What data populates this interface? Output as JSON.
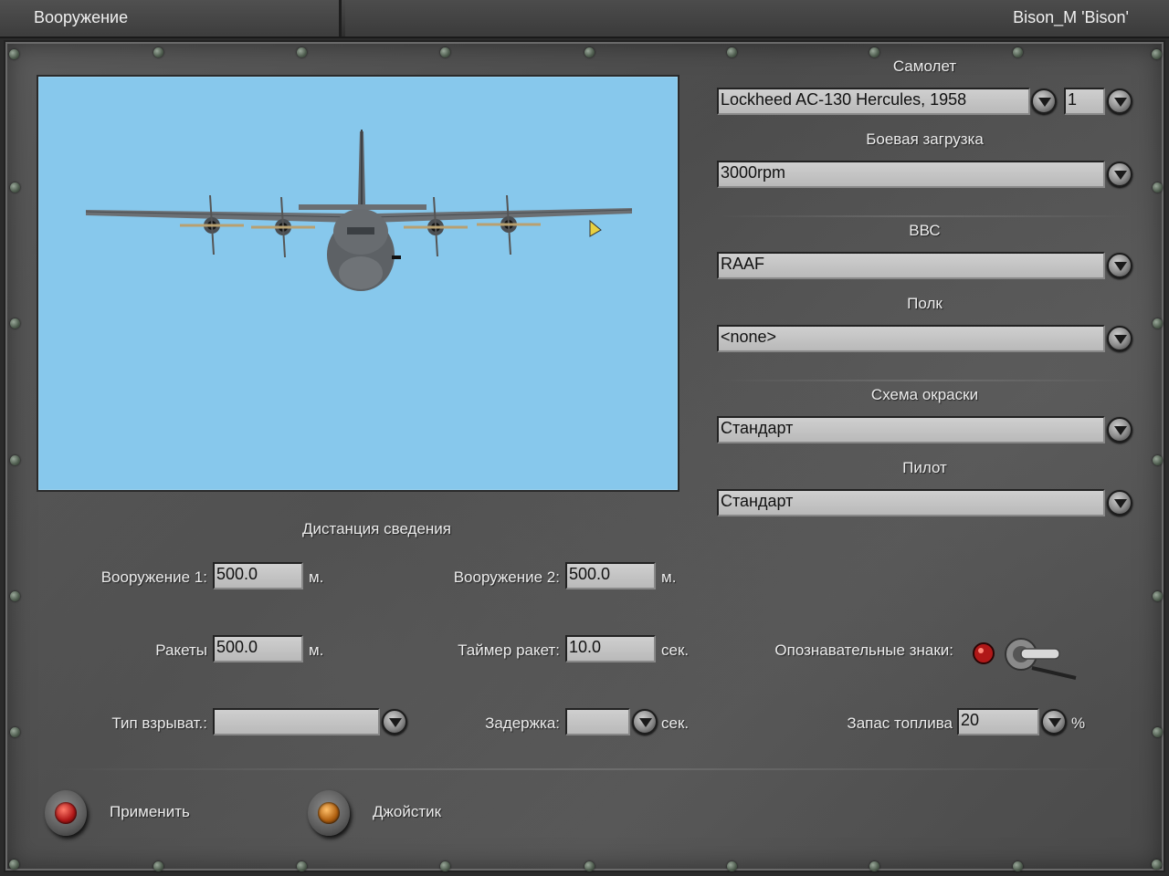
{
  "window": {
    "title": "Вооружение",
    "user": "Bison_M 'Bison'"
  },
  "aircraft": {
    "label": "Самолет",
    "model": "Lockheed AC-130 Hercules, 1958",
    "count": "1"
  },
  "loadout": {
    "label": "Боевая загрузка",
    "value": "3000rpm"
  },
  "air_force": {
    "label": "ВВС",
    "value": "RAAF"
  },
  "regiment": {
    "label": "Полк",
    "value": "<none>"
  },
  "skin": {
    "label": "Схема окраски",
    "value": "Стандарт"
  },
  "pilot": {
    "label": "Пилот",
    "value": "Стандарт"
  },
  "convergence": {
    "title": "Дистанция сведения",
    "weapon1_label": "Вооружение 1:",
    "weapon1_value": "500.0",
    "weapon1_unit": "м.",
    "weapon2_label": "Вооружение 2:",
    "weapon2_value": "500.0",
    "weapon2_unit": "м.",
    "rockets_label": "Ракеты",
    "rockets_value": "500.0",
    "rockets_unit": "м.",
    "rocket_timer_label": "Таймер ракет:",
    "rocket_timer_value": "10.0",
    "rocket_timer_unit": "сек.",
    "fuze_label": "Тип взрыват.:",
    "fuze_value": "",
    "delay_label": "Задержка:",
    "delay_value": "",
    "delay_unit": "сек."
  },
  "markings": {
    "label": "Опознавательные знаки:"
  },
  "fuel": {
    "label": "Запас топлива",
    "value": "20",
    "unit": "%"
  },
  "buttons": {
    "apply": "Применить",
    "joystick": "Джойстик"
  },
  "icons": {
    "dropdown": "chevron-down-icon",
    "apply_lamp": "red-lamp-icon",
    "joystick_lamp": "amber-lamp-icon",
    "toggle": "toggle-switch-icon"
  }
}
